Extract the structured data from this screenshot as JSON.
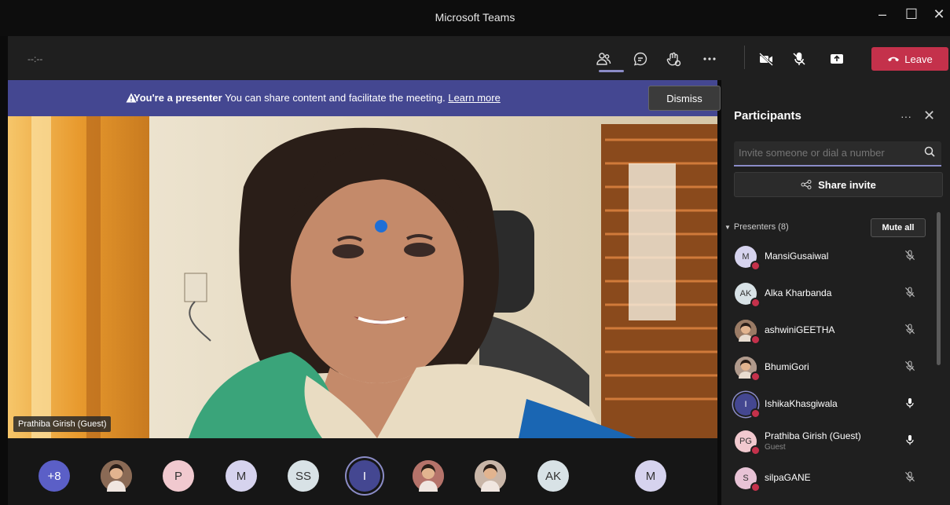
{
  "window": {
    "title": "Microsoft Teams",
    "minimize": "–",
    "maximize": "☐",
    "close": "✕"
  },
  "toolbar": {
    "timer": "--:--",
    "leave_label": "Leave"
  },
  "banner": {
    "bold": "You're a presenter",
    "message": "You can share content and facilitate the meeting.",
    "link": "Learn more",
    "dismiss": "Dismiss"
  },
  "stage": {
    "name_chip": "Prathiba Girish (Guest)"
  },
  "strip": {
    "avatars": [
      {
        "label": "+8",
        "bg": "#5b5fc7",
        "color": "#ffffff"
      },
      {
        "label": "",
        "bg": "#8a6a55",
        "photo": true
      },
      {
        "label": "P",
        "bg": "#f1c9cf",
        "color": "#333"
      },
      {
        "label": "M",
        "bg": "#d6d3ee",
        "color": "#333"
      },
      {
        "label": "SS",
        "bg": "#d8e2e6",
        "color": "#333"
      },
      {
        "label": "I",
        "bg": "#444791",
        "color": "#ffffff",
        "active": true
      },
      {
        "label": "",
        "bg": "#b5736a",
        "photo": true
      },
      {
        "label": "",
        "bg": "#c9b6a8",
        "photo": true
      },
      {
        "label": "AK",
        "bg": "#d8e2e6",
        "color": "#333"
      },
      {
        "label": "M",
        "bg": "#d6d3ee",
        "color": "#333"
      }
    ]
  },
  "panel": {
    "title": "Participants",
    "more": "···",
    "close": "✕",
    "invite_placeholder": "Invite someone or dial a number",
    "share_invite": "Share invite",
    "section": "Presenters (8)",
    "mute_all": "Mute all",
    "participants": [
      {
        "initials": "M",
        "name": "MansiGusaiwal",
        "avatar_bg": "#d6d3ee",
        "mic": "muted"
      },
      {
        "initials": "AK",
        "name": "Alka Kharbanda",
        "avatar_bg": "#d8e2e6",
        "mic": "muted"
      },
      {
        "initials": "",
        "name": "ashwiniGEETHA",
        "avatar_bg": "#9a7b65",
        "mic": "muted",
        "photo": true
      },
      {
        "initials": "",
        "name": "BhumiGori",
        "avatar_bg": "#b09a8c",
        "mic": "muted",
        "photo": true
      },
      {
        "initials": "I",
        "name": "IshikaKhasgiwala",
        "avatar_bg": "#444791",
        "mic": "on",
        "active": true
      },
      {
        "initials": "PG",
        "name": "Prathiba Girish (Guest)",
        "sub": "Guest",
        "avatar_bg": "#f1c9cf",
        "mic": "on"
      },
      {
        "initials": "S",
        "name": "silpaGANE",
        "avatar_bg": "#e8c3d6",
        "mic": "muted"
      }
    ]
  }
}
